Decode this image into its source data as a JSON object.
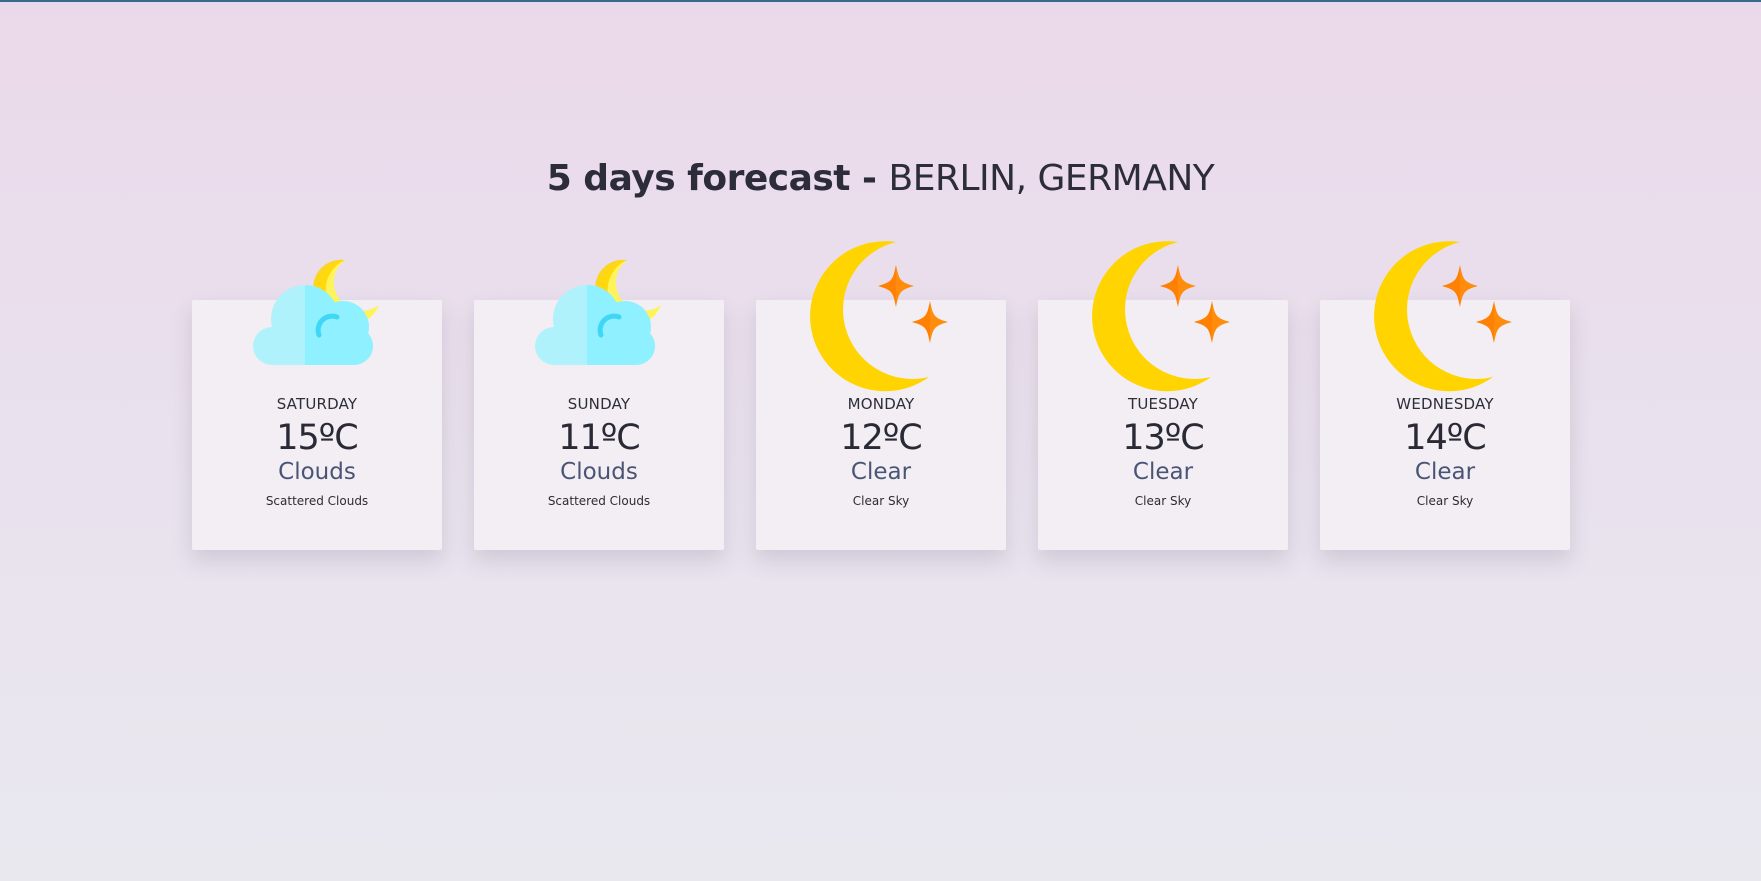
{
  "page": {
    "title_bold": "5 days forecast -",
    "title_location": "BERLIN, GERMANY"
  },
  "forecast": [
    {
      "day": "SATURDAY",
      "temp": "15ºC",
      "main": "Clouds",
      "desc": "Scattered Clouds",
      "icon": "cloud-moon-icon"
    },
    {
      "day": "SUNDAY",
      "temp": "11ºC",
      "main": "Clouds",
      "desc": "Scattered Clouds",
      "icon": "cloud-moon-icon"
    },
    {
      "day": "MONDAY",
      "temp": "12ºC",
      "main": "Clear",
      "desc": "Clear Sky",
      "icon": "moon-stars-icon"
    },
    {
      "day": "TUESDAY",
      "temp": "13ºC",
      "main": "Clear",
      "desc": "Clear Sky",
      "icon": "moon-stars-icon"
    },
    {
      "day": "WEDNESDAY",
      "temp": "14ºC",
      "main": "Clear",
      "desc": "Clear Sky",
      "icon": "moon-stars-icon"
    }
  ],
  "colors": {
    "moon_yellow": "#ffd400",
    "star_orange": "#ff8c0a",
    "cloud_light": "#b0f2fb",
    "cloud_dark": "#8ff0ff",
    "card_bg": "#f2eef3"
  }
}
